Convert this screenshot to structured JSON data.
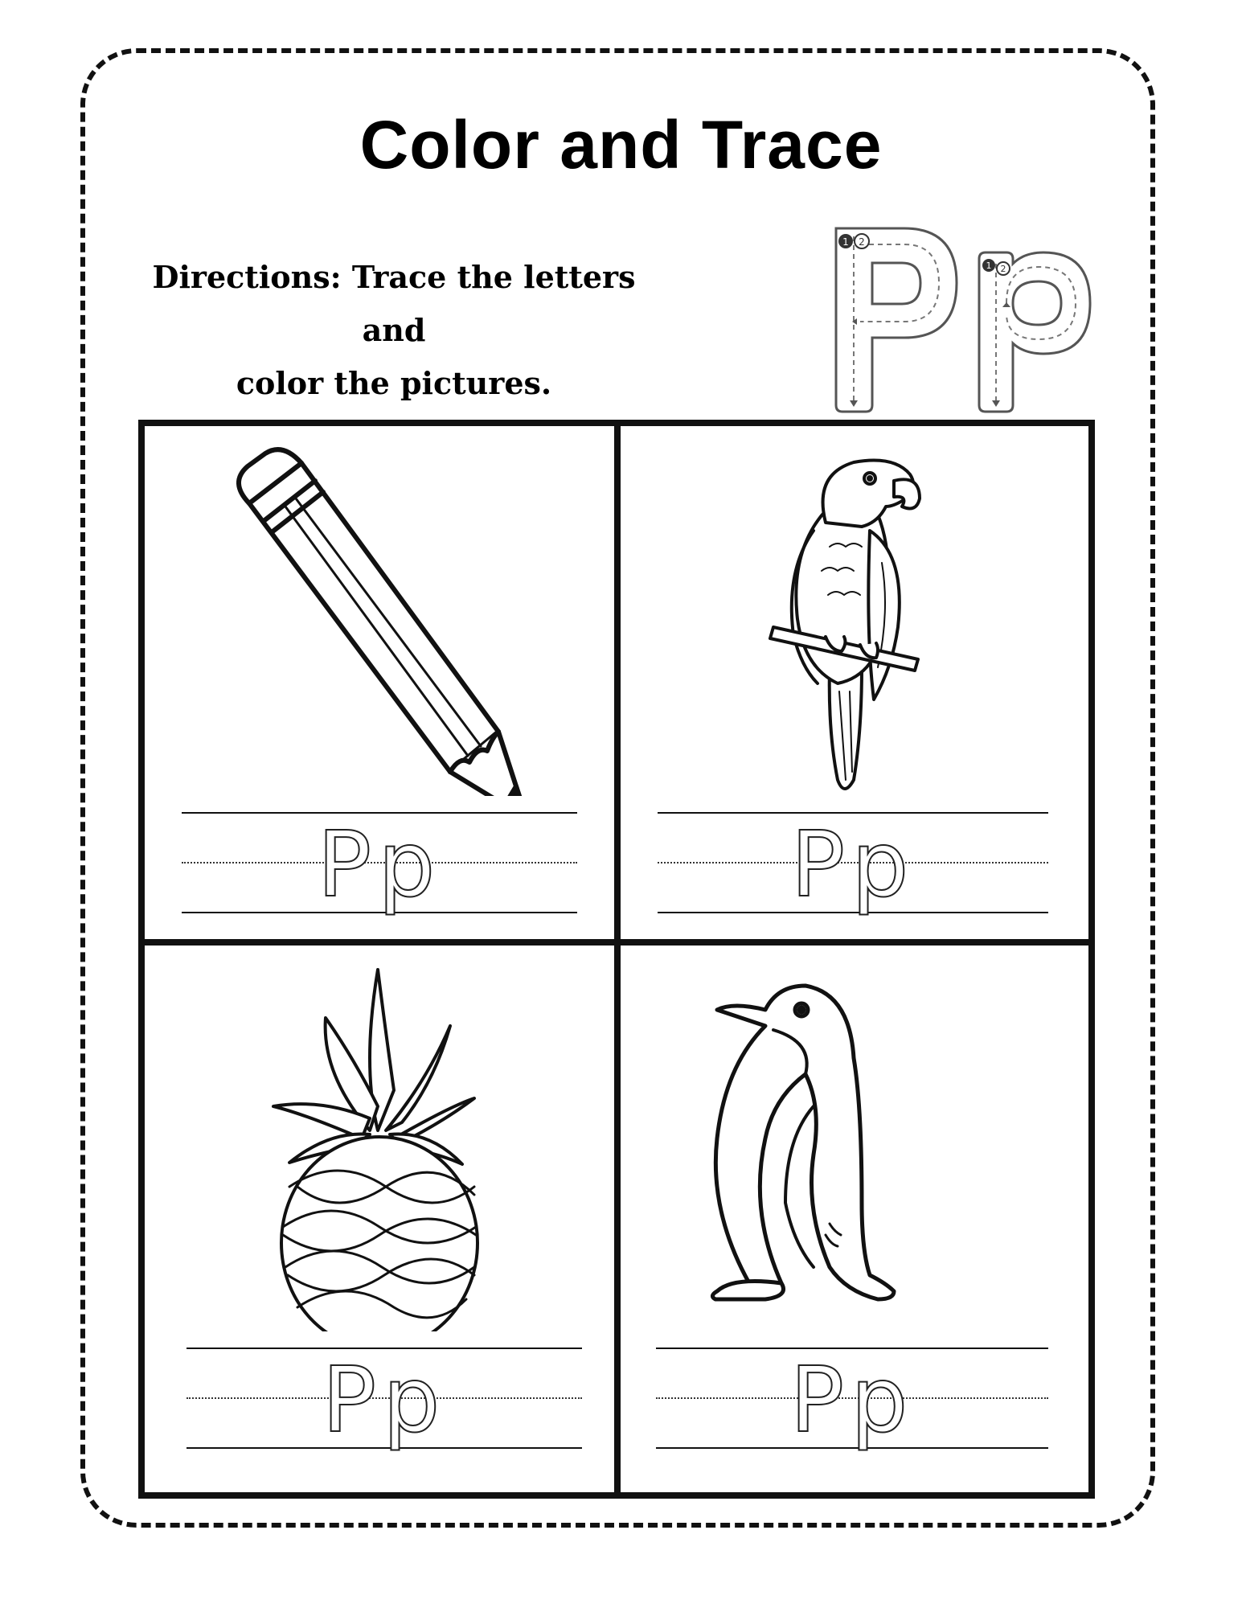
{
  "worksheet": {
    "title": "Color and Trace",
    "directions_line1": "Directions: Trace the letters and",
    "directions_line2": "color the pictures.",
    "letter_upper": "P",
    "letter_lower": "p",
    "stroke_order": [
      "1",
      "2"
    ]
  },
  "cells": [
    {
      "picture": "pencil",
      "trace_text": "Pp"
    },
    {
      "picture": "parrot",
      "trace_text": "Pp"
    },
    {
      "picture": "pineapple",
      "trace_text": "Pp"
    },
    {
      "picture": "penguin",
      "trace_text": "Pp"
    }
  ],
  "colors": {
    "ink": "#111111",
    "paper": "#ffffff"
  }
}
